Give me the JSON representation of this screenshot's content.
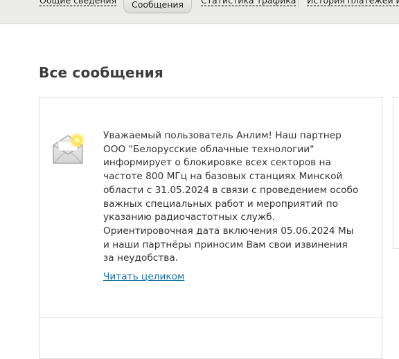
{
  "nav": {
    "tabs": [
      {
        "label": "Общие сведения",
        "active": false
      },
      {
        "label": "Сообщения",
        "active": true
      },
      {
        "label": "Статистика трафика",
        "active": false
      },
      {
        "label": "История платежей и с",
        "active": false
      }
    ]
  },
  "main": {
    "title": "Все сообщения",
    "messages": [
      {
        "icon": "new-mail-envelope-icon",
        "text": "Уважаемый пользователь Анлим! Наш партнер ООО \"Белорусские облачные технологии\" информирует о блокировке всех секторов на частоте 800 МГц на базовых станциях Минской области с 31.05.2024 в связи с проведением особо важных специальных работ и мероприятий по указанию радиочастотных служб. Ориентировочная дата включения 05.06.2024 Мы и наши партнёры приносим Вам свои извинения за неудобства.",
        "read_more": "Читать целиком"
      }
    ]
  },
  "colors": {
    "topbar_bg": "#ecece8",
    "link": "#1a6fa8",
    "title": "#3c3c3c"
  }
}
